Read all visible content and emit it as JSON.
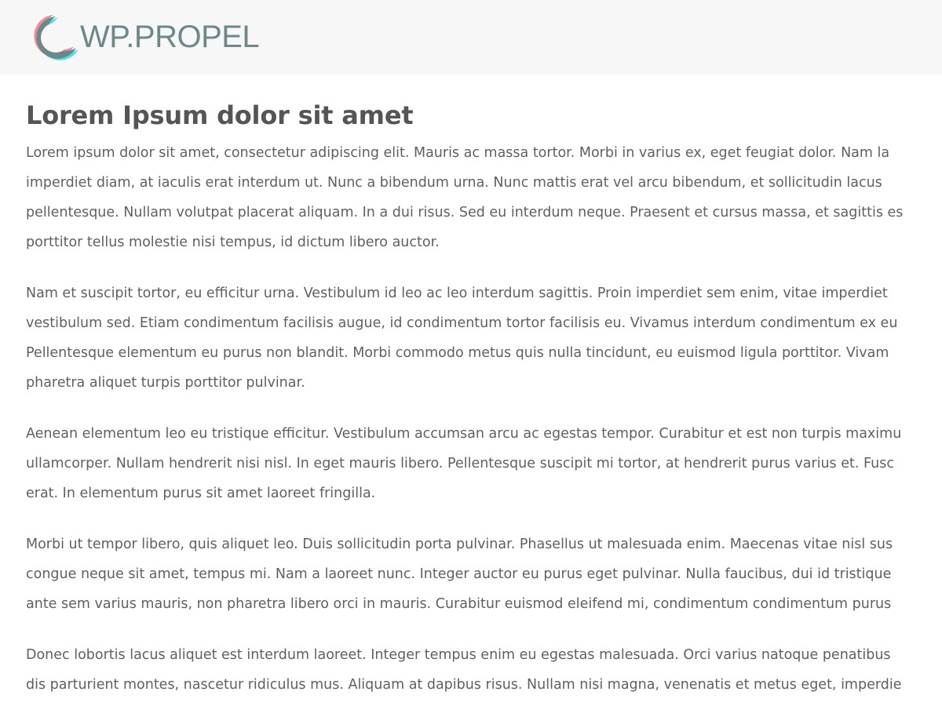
{
  "header": {
    "logo_text": "WP.PROPEL",
    "logo_icon": "crescent-ring-logo",
    "colors": {
      "background": "#f7f7f7",
      "logo_gray": "#6e8789",
      "logo_pink": "#f08a96",
      "logo_cyan": "#49e6f0"
    }
  },
  "main": {
    "title": "Lorem Ipsum dolor sit amet",
    "paragraphs": [
      {
        "lines": [
          "Lorem ipsum dolor sit amet, consectetur adipiscing elit. Mauris ac massa tortor. Morbi in varius ex, eget feugiat dolor. Nam la",
          "imperdiet diam, at iaculis erat interdum ut. Nunc a bibendum urna. Nunc mattis erat vel arcu bibendum, et sollicitudin lacus",
          "pellentesque. Nullam volutpat placerat aliquam. In a dui risus. Sed eu interdum neque. Praesent et cursus massa, et sagittis es",
          "porttitor tellus molestie nisi tempus, id dictum libero auctor."
        ]
      },
      {
        "lines": [
          "Nam et suscipit tortor, eu efficitur urna. Vestibulum id leo ac leo interdum sagittis. Proin imperdiet sem enim, vitae imperdiet",
          "vestibulum sed. Etiam condimentum facilisis augue, id condimentum tortor facilisis eu. Vivamus interdum condimentum ex eu",
          "Pellentesque elementum eu purus non blandit. Morbi commodo metus quis nulla tincidunt, eu euismod ligula porttitor. Vivam",
          "pharetra aliquet turpis porttitor pulvinar."
        ]
      },
      {
        "lines": [
          "Aenean elementum leo eu tristique efficitur. Vestibulum accumsan arcu ac egestas tempor. Curabitur et est non turpis maximu",
          "ullamcorper. Nullam hendrerit nisi nisl. In eget mauris libero. Pellentesque suscipit mi tortor, at hendrerit purus varius et. Fusc",
          "erat. In elementum purus sit amet laoreet fringilla."
        ]
      },
      {
        "lines": [
          "Morbi ut tempor libero, quis aliquet leo. Duis sollicitudin porta pulvinar. Phasellus ut malesuada enim. Maecenas vitae nisl sus",
          "congue neque sit amet, tempus mi. Nam a laoreet nunc. Integer auctor eu purus eget pulvinar. Nulla faucibus, dui id tristique",
          "ante sem varius mauris, non pharetra libero orci in mauris. Curabitur euismod eleifend mi, condimentum condimentum purus"
        ]
      },
      {
        "lines": [
          "Donec lobortis lacus aliquet est interdum laoreet. Integer tempus enim eu egestas malesuada. Orci varius natoque penatibus",
          "dis parturient montes, nascetur ridiculus mus. Aliquam at dapibus risus. Nullam nisi magna, venenatis et metus eget, imperdie"
        ]
      }
    ]
  }
}
